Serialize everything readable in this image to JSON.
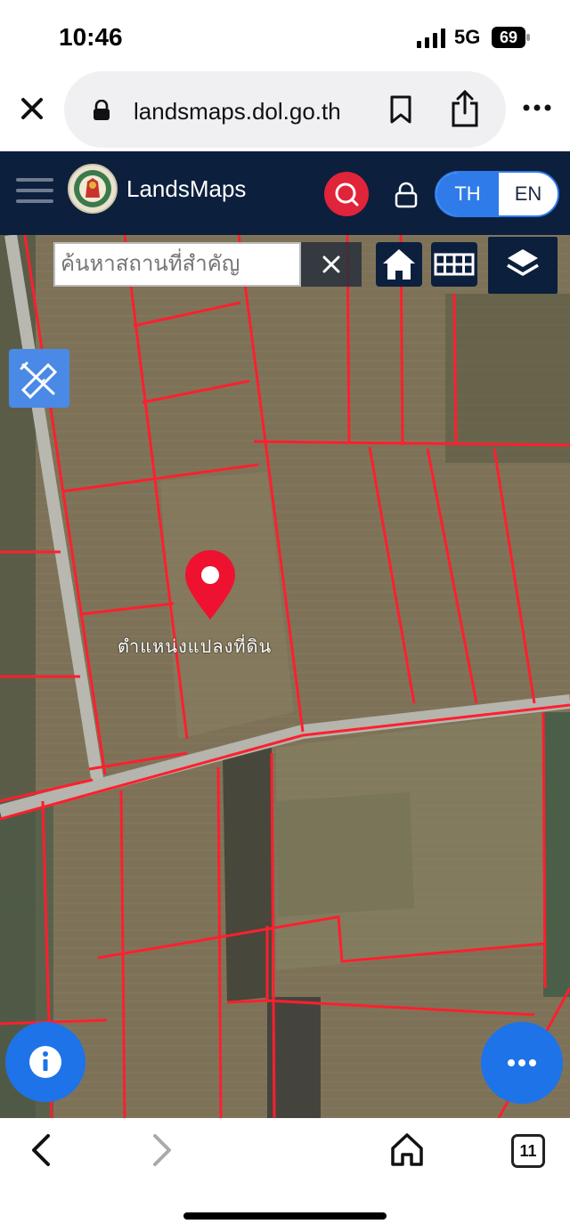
{
  "status_bar": {
    "time": "10:46",
    "network": "5G",
    "battery": "69"
  },
  "browser": {
    "url": "landsmaps.dol.go.th",
    "tab_count": "11"
  },
  "app": {
    "brand": "LandsMaps",
    "languages": {
      "th": "TH",
      "en": "EN",
      "active": "TH"
    },
    "search_placeholder": "ค้นหาสถานที่สำคัญ"
  },
  "map": {
    "parcel_label": "ตำแหน่งแปลงที่ดิน"
  },
  "colors": {
    "header": "#0c1f3d",
    "accent_blue": "#1e73e8",
    "pin_red": "#e0243a",
    "parcel_line": "#ff1f2e"
  },
  "icons": [
    "close-icon",
    "lock-icon",
    "bookmark-icon",
    "share-icon",
    "more-icon",
    "hamburger-icon",
    "search-icon",
    "home-icon",
    "grid-icon",
    "layers-icon",
    "measure-icon",
    "info-icon",
    "ellipsis-icon",
    "back-icon",
    "forward-icon",
    "home-nav-icon",
    "tabs-icon"
  ]
}
